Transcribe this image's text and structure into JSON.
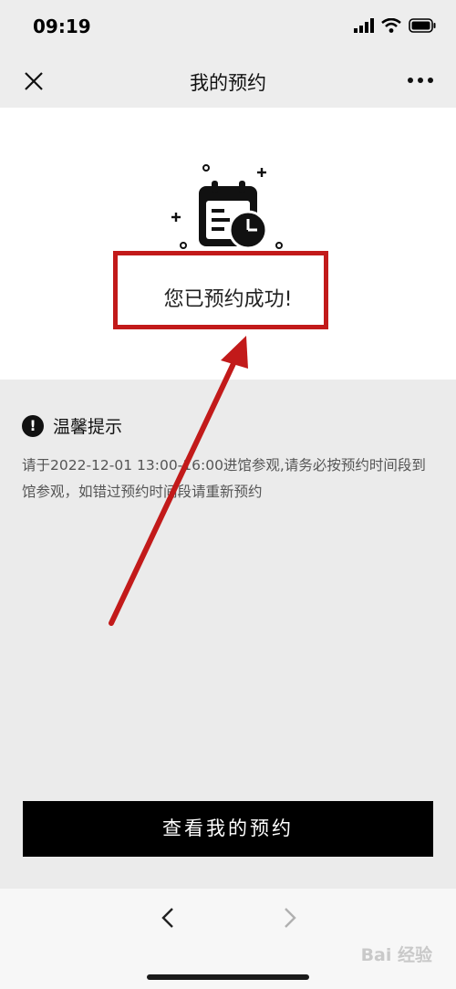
{
  "status_bar": {
    "time": "09:19"
  },
  "nav": {
    "title": "我的预约"
  },
  "success": {
    "message": "您已预约成功!"
  },
  "tips": {
    "title": "温馨提示",
    "icon_label": "!",
    "body": "请于2022-12-01 13:00-16:00进馆参观,请务必按预约时间段到馆参观，如错过预约时间段请重新预约"
  },
  "actions": {
    "view_button_label": "查看我的预约"
  },
  "watermark": {
    "text": "Bai 经验"
  },
  "colors": {
    "highlight": "#c21a1a",
    "button_bg": "#000000",
    "panel_bg": "#ffffff",
    "page_bg": "#ebebeb"
  },
  "icons": [
    "close-icon",
    "more-icon",
    "calendar-clock-icon",
    "alert-icon",
    "back-icon",
    "forward-icon",
    "signal-icon",
    "wifi-icon",
    "battery-icon"
  ]
}
